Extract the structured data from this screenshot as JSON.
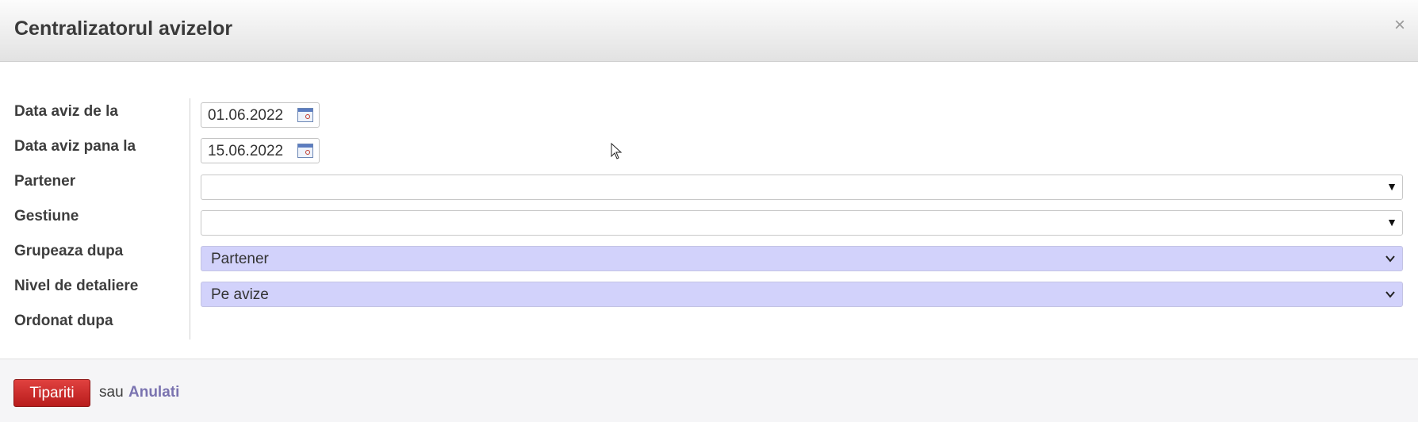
{
  "dialog": {
    "title": "Centralizatorul avizelor",
    "close_label": "×"
  },
  "form": {
    "fields": [
      {
        "label": "Data aviz de la",
        "value": "01.06.2022"
      },
      {
        "label": "Data aviz pana la",
        "value": "15.06.2022"
      },
      {
        "label": "Partener",
        "value": ""
      },
      {
        "label": "Gestiune",
        "value": ""
      },
      {
        "label": "Grupeaza dupa",
        "value": "Partener"
      },
      {
        "label": "Nivel de detaliere",
        "value": "Pe avize"
      },
      {
        "label": "Ordonat dupa",
        "value": ""
      }
    ],
    "dropdown_arrow": "▼"
  },
  "footer": {
    "print_label": "Tipariti",
    "separator": "sau",
    "cancel_label": "Anulati"
  },
  "icons": {
    "calendar": "calendar-icon",
    "dropdown": "dropdown-arrow-icon",
    "chevron": "chevron-down-icon",
    "close": "close-icon",
    "cursor": "mouse-pointer-icon"
  },
  "colors": {
    "print_button": "#c62828",
    "select_bg": "#d2d2fb",
    "cancel_link": "#7a73b0"
  }
}
